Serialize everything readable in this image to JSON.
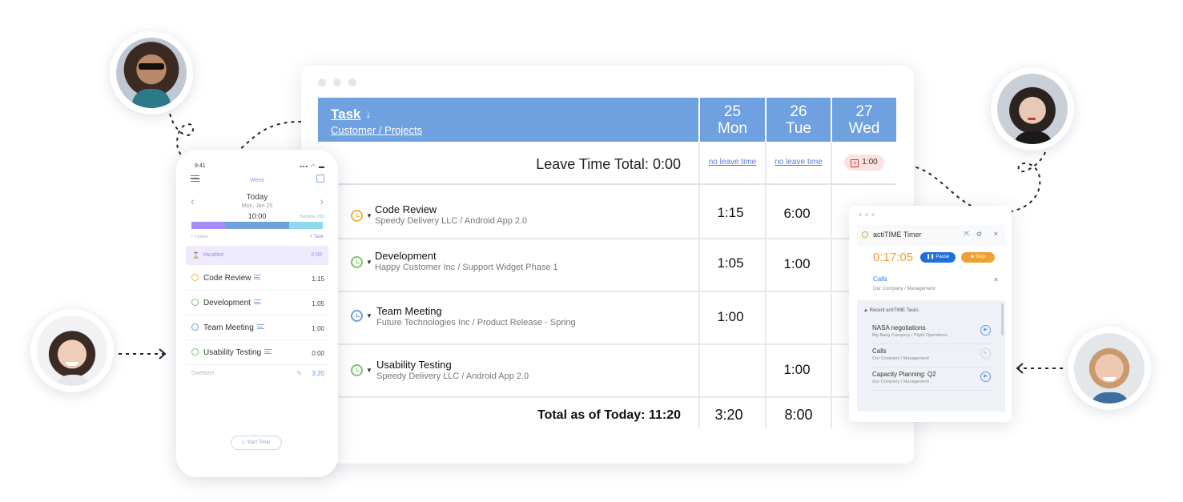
{
  "timesheet": {
    "task_header": "Task",
    "task_subheader": "Customer / Projects",
    "days": [
      {
        "num": "25",
        "name": "Mon"
      },
      {
        "num": "26",
        "name": "Tue"
      },
      {
        "num": "27",
        "name": "Wed"
      }
    ],
    "leave_label": "Leave Time Total:",
    "leave_total": "0:00",
    "leave_cells": [
      "no leave time",
      "no leave time",
      "1:00"
    ],
    "rows": [
      {
        "name": "Code Review",
        "sub": "Speedy Delivery LLC  /  Android App 2.0",
        "mon": "1:15",
        "tue": "6:00",
        "wed": "",
        "icon_color": "#f0b340"
      },
      {
        "name": "Development",
        "sub": "Happy Customer Inc  /  Support Widget Phase 1",
        "mon": "1:05",
        "tue": "1:00",
        "wed": "",
        "icon_color": "#7cc46e"
      },
      {
        "name": "Team Meeting",
        "sub": "Future Technologies Inc  /  Product Release - Spring",
        "mon": "1:00",
        "tue": "",
        "wed": "",
        "icon_color": "#6fa0e0"
      },
      {
        "name": "Usability Testing",
        "sub": "Speedy Delivery LLC  /  Android App 2.0",
        "mon": "",
        "tue": "1:00",
        "wed": "",
        "icon_color": "#7cc46e"
      }
    ],
    "total_label": "Total as of Today: 11:20",
    "totals": [
      "3:20",
      "8:00"
    ]
  },
  "phone": {
    "clock": "9:41",
    "status": "▪▪▪ ◠ ▬",
    "week_label": "Week",
    "today": "Today",
    "date": "Mon, Jan 25",
    "total": "10:00",
    "overtime_small": "Overtime 2:00",
    "bar_colors": [
      "#a78bfa",
      "#6fa0e0",
      "#8fd8f0"
    ],
    "leave_label": "+ Leave",
    "task_label": "+ Task",
    "vacation_label": "Vacation",
    "vacation_value": "2:00",
    "items": [
      {
        "name": "Code Review",
        "value": "1:15",
        "color": "#f0b340"
      },
      {
        "name": "Development",
        "value": "1:05",
        "color": "#7cc46e"
      },
      {
        "name": "Team Meeting",
        "value": "1:00",
        "color": "#6fa0e0"
      },
      {
        "name": "Usability Testing",
        "value": "0:00",
        "color": "#7cc46e"
      }
    ],
    "overtime_label": "Overtime",
    "overtime_value": "3:20",
    "start_timer": "▷  Start Timer"
  },
  "timer": {
    "title": "actiTIME Timer",
    "clock": "0:17:05",
    "pause": "❚❚ Pause",
    "stop": "■  Stop",
    "current_task": "Calls",
    "current_sub": "Our Company / Management",
    "recent_header": "▲  Recent actiTIME Tasks",
    "recent": [
      {
        "name": "NASA negotiations",
        "sub": "Big Bang Company / Flight Operations"
      },
      {
        "name": "Calls",
        "sub": "Our Company / Management"
      },
      {
        "name": "Capacity Planning: Q2",
        "sub": "Our Company / Management"
      }
    ]
  },
  "colors": {
    "header_blue": "#6fa0e0",
    "timer_orange": "#f0a030",
    "pause_blue": "#1e6fd9",
    "link_blue": "#5b7bd6"
  },
  "icons": [
    "sort-arrow-icon",
    "clock-icon",
    "menu-icon",
    "calendar-icon",
    "play-icon",
    "close-icon",
    "settings-icon",
    "external-link-icon",
    "pencil-icon"
  ]
}
